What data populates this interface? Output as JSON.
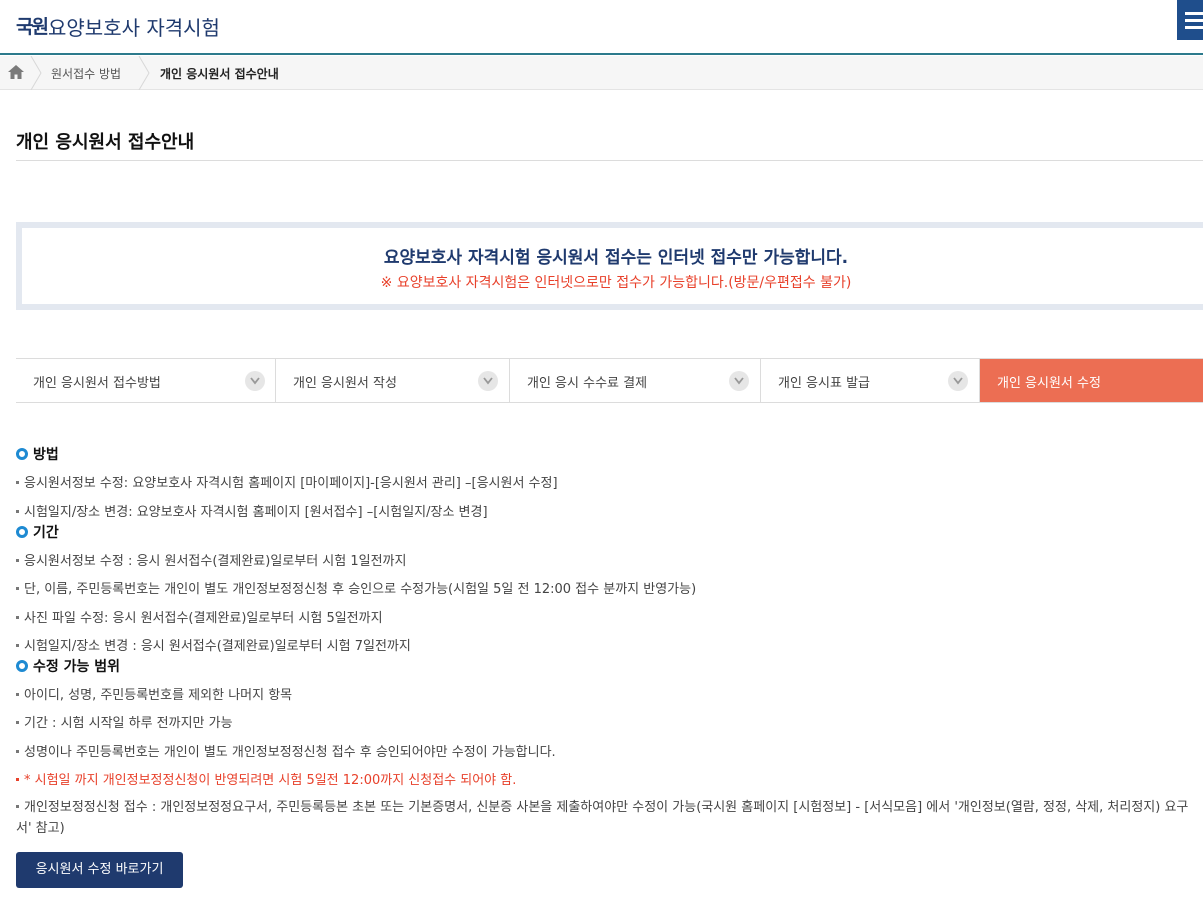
{
  "header": {
    "logo_text": "국원",
    "site_title": "요양보호사 자격시험",
    "menu_icon": "hamburger-menu-icon"
  },
  "breadcrumb": {
    "home_icon": "home-icon",
    "items": [
      "원서접수 방법",
      "개인 응시원서 접수안내"
    ]
  },
  "page_title": "개인 응시원서 접수안내",
  "notice": {
    "main": "요양보호사 자격시험 응시원서 접수는 인터넷 접수만 가능합니다.",
    "sub": "※ 요양보호사 자격시험은 인터넷으로만 접수가 가능합니다.(방문/우편접수 불가)"
  },
  "steps": [
    {
      "label": "개인 응시원서 접수방법"
    },
    {
      "label": "개인 응시원서 작성"
    },
    {
      "label": "개인 응시 수수료 결제"
    },
    {
      "label": "개인 응시표 발급"
    },
    {
      "label": "개인 응시원서 수정",
      "active": true
    }
  ],
  "sections": {
    "method": {
      "heading": "방법",
      "items": [
        "응시원서정보 수정: 요양보호사 자격시험 홈페이지 [마이페이지]-[응시원서 관리] –[응시원서 수정]",
        "시험일지/장소 변경: 요양보호사 자격시험 홈페이지 [원서접수] –[시험일지/장소 변경]"
      ]
    },
    "period": {
      "heading": "기간",
      "items": [
        "응시원서정보 수정 : 응시 원서접수(결제완료)일로부터 시험 1일전까지",
        "단, 이름, 주민등록번호는 개인이 별도 개인정보정정신청 후 승인으로 수정가능(시험일 5일 전 12:00 접수 분까지 반영가능)",
        "사진 파일 수정: 응시 원서접수(결제완료)일로부터 시험 5일전까지",
        "시험일지/장소 변경 : 응시 원서접수(결제완료)일로부터 시험 7일전까지"
      ]
    },
    "scope": {
      "heading": "수정 가능 범위",
      "items": [
        "아이디, 성명, 주민등록번호를 제외한 나머지 항목",
        "기간 : 시험 시작일 하루 전까지만 가능",
        "성명이나 주민등록번호는 개인이 별도 개인정보정정신청 접수 후 승인되어야만 수정이 가능합니다."
      ],
      "warning": "* 시험일 까지 개인정보정정신청이 반영되려면 시험 5일전 12:00까지 신청접수 되어야 함.",
      "last": "개인정보정정신청 접수 : 개인정보정정요구서, 주민등록등본 초본 또는 기본증명서, 신분증 사본을 제출하여야만 수정이 가능(국시원 홈페이지 [시험정보] - [서식모음] 에서 '개인정보(열람, 정정, 삭제, 처리정지) 요구서' 참고)"
    }
  },
  "cta_button": "응시원서 수정 바로가기",
  "colors": {
    "brand_navy": "#1f3a6e",
    "accent_orange": "#ec6e53",
    "warning_red": "#e8412b",
    "ring_blue": "#1e8ad2"
  }
}
